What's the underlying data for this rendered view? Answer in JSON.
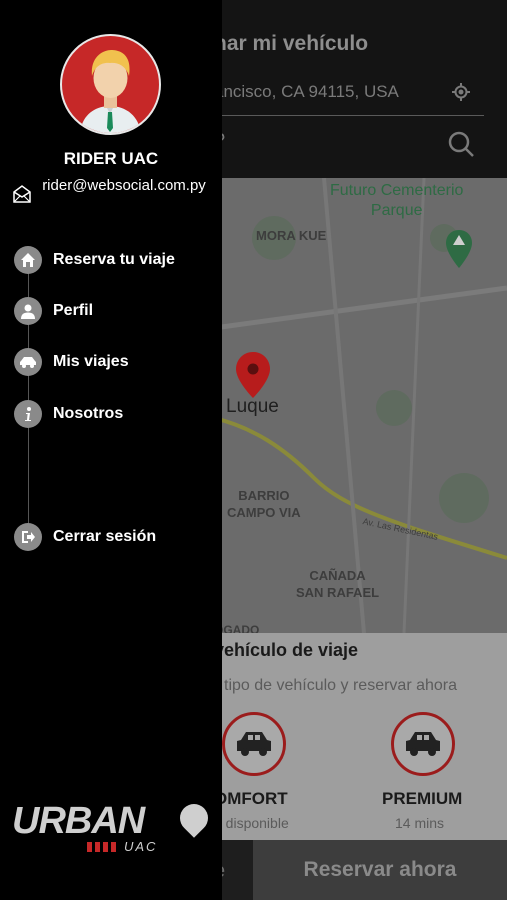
{
  "background": {
    "title": "nar mi vehículo",
    "address": "ancisco, CA 94115, USA",
    "search_text": "?",
    "map": {
      "label_futuro": "Futuro Cementerio\nParque",
      "label_mora": "MORA KUE",
      "label_luque": "Luque",
      "label_barrio": "BARRIO\nCAMPO VIA",
      "label_road": "Av. Las Residentas",
      "label_canada": "CAÑADA\nSAN RAFAEL",
      "label_gado": "OGADO"
    },
    "panel": {
      "title": "vehículo de viaje",
      "subtitle": "tipo de vehículo y reservar ahora",
      "vehicles": [
        {
          "name": "OMFORT",
          "status": "o disponible"
        },
        {
          "name": "PREMIUM",
          "status": "14 mins"
        }
      ]
    },
    "buttons": {
      "left_fragment": "e",
      "reserve": "Reservar ahora"
    }
  },
  "drawer": {
    "user_name": "RIDER UAC",
    "email": "rider@websocial.com.py",
    "menu": [
      {
        "label": "Reserva tu viaje",
        "icon": "home-icon"
      },
      {
        "label": "Perfil",
        "icon": "profile-icon"
      },
      {
        "label": "Mis viajes",
        "icon": "car-icon"
      },
      {
        "label": "Nosotros",
        "icon": "info-icon"
      },
      {
        "label": "Cerrar sesión",
        "icon": "logout-icon"
      }
    ],
    "logo": {
      "text": "URBAN",
      "sub": "UAC"
    }
  },
  "colors": {
    "accent": "#c62828",
    "drawer": "#000000",
    "icon_bg": "#8a8a8a"
  }
}
